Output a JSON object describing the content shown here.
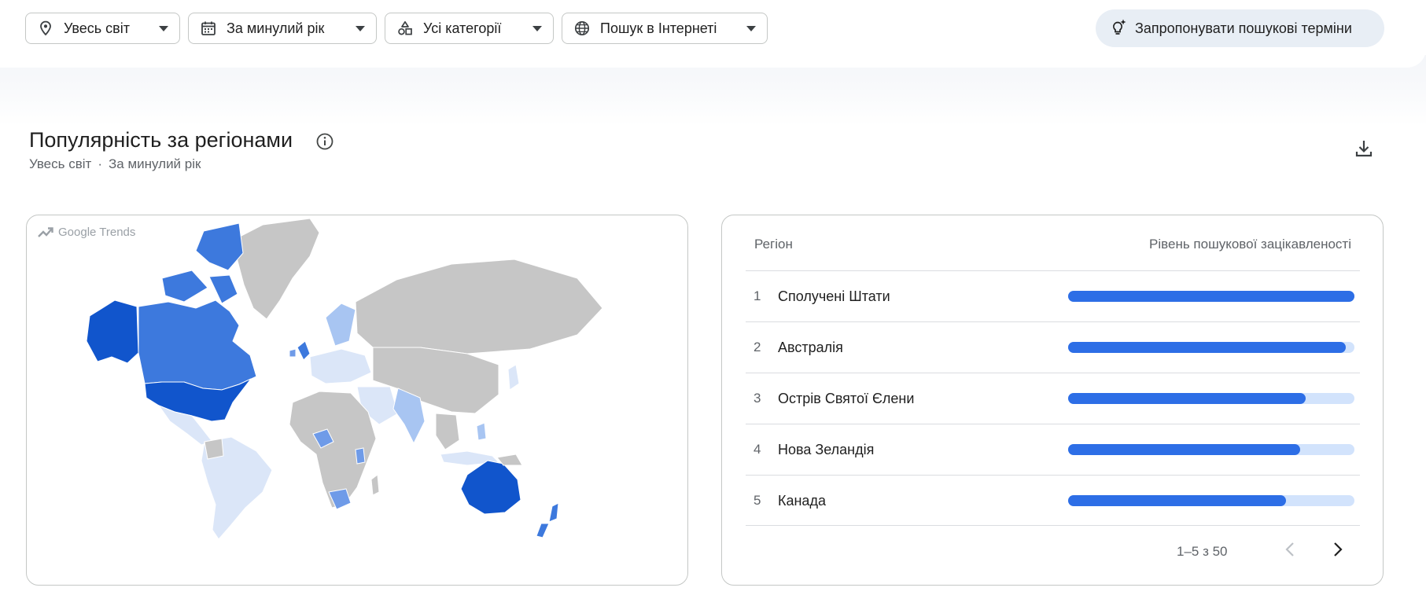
{
  "filters": {
    "location": "Увесь світ",
    "time_range": "За минулий рік",
    "category": "Усі категорії",
    "search_type": "Пошук в Інтернеті"
  },
  "suggest_button": "Запропонувати пошукові терміни",
  "section": {
    "title": "Популярність за регіонами",
    "subtitle_location": "Увесь світ",
    "subtitle_separator": "·",
    "subtitle_time": "За минулий рік"
  },
  "map": {
    "watermark": "Google Trends",
    "colors": {
      "max": "#1155cc",
      "high": "#3d79dd",
      "mid": "#6f9be8",
      "low": "#a8c5f2",
      "lowest": "#dbe6f8",
      "nodata": "#c6c6c6"
    }
  },
  "table": {
    "header_region": "Регіон",
    "header_interest": "Рівень пошукової зацікавленості",
    "rows": [
      {
        "rank": "1",
        "region": "Сполучені Штати",
        "value": 100
      },
      {
        "rank": "2",
        "region": "Австралія",
        "value": 97
      },
      {
        "rank": "3",
        "region": "Острів Святої Єлени",
        "value": 83
      },
      {
        "rank": "4",
        "region": "Нова Зеландія",
        "value": 81
      },
      {
        "rank": "5",
        "region": "Канада",
        "value": 76
      }
    ],
    "pagination": "1–5 з 50"
  },
  "icons": {
    "location": "location-pin-icon",
    "calendar": "calendar-icon",
    "category": "category-shapes-icon",
    "web": "globe-icon",
    "suggest": "sparkle-lightbulb-icon",
    "info": "info-icon",
    "download": "download-icon",
    "prev": "chevron-left-icon",
    "next": "chevron-right-icon"
  }
}
